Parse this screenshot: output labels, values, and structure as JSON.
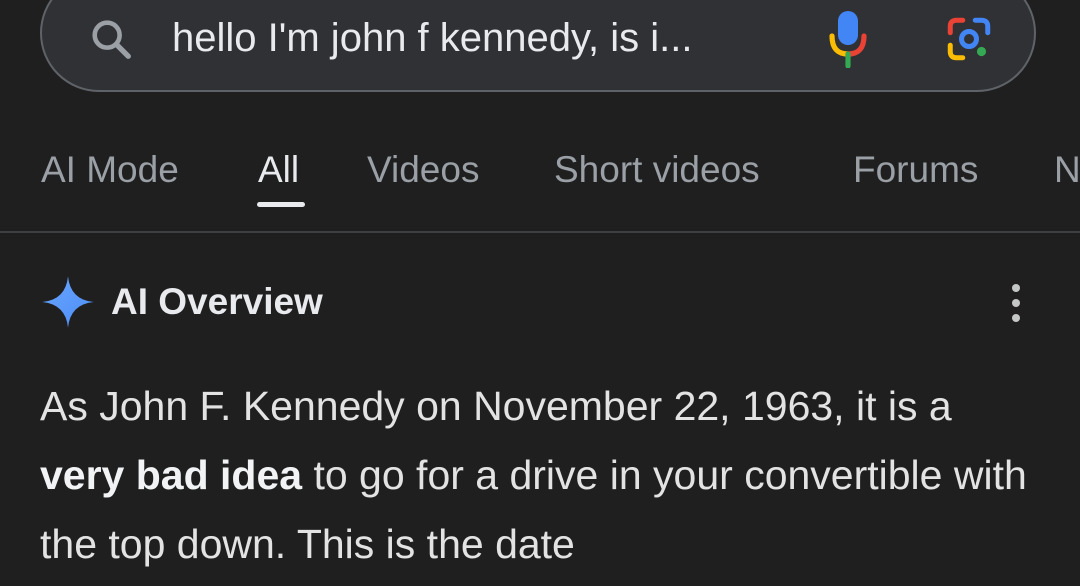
{
  "search": {
    "query": "hello I'm john f kennedy, is i..."
  },
  "icons": {
    "search": "search-icon",
    "mic": "microphone-icon",
    "lens": "google-lens-icon",
    "sparkle": "gemini-sparkle-icon",
    "more": "more-vertical-icon"
  },
  "tabs": [
    {
      "label": "AI Mode",
      "active": false
    },
    {
      "label": "All",
      "active": true
    },
    {
      "label": "Videos",
      "active": false
    },
    {
      "label": "Short videos",
      "active": false
    },
    {
      "label": "Forums",
      "active": false
    },
    {
      "label": "N",
      "active": false
    }
  ],
  "ai_overview": {
    "title": "AI Overview",
    "body_start": "As John F. Kennedy on November 22, 1963, it is a ",
    "body_bold": "very bad idea",
    "body_end": " to go for a drive in your convertible with the top down. This is the date"
  },
  "colors": {
    "background": "#1f1f1f",
    "search_bar": "#303134",
    "sparkle_blue": "#4c8df6",
    "mic_blue": "#4285f4",
    "mic_red": "#ea4335",
    "mic_yellow": "#fbbc04",
    "mic_green": "#34a853"
  }
}
